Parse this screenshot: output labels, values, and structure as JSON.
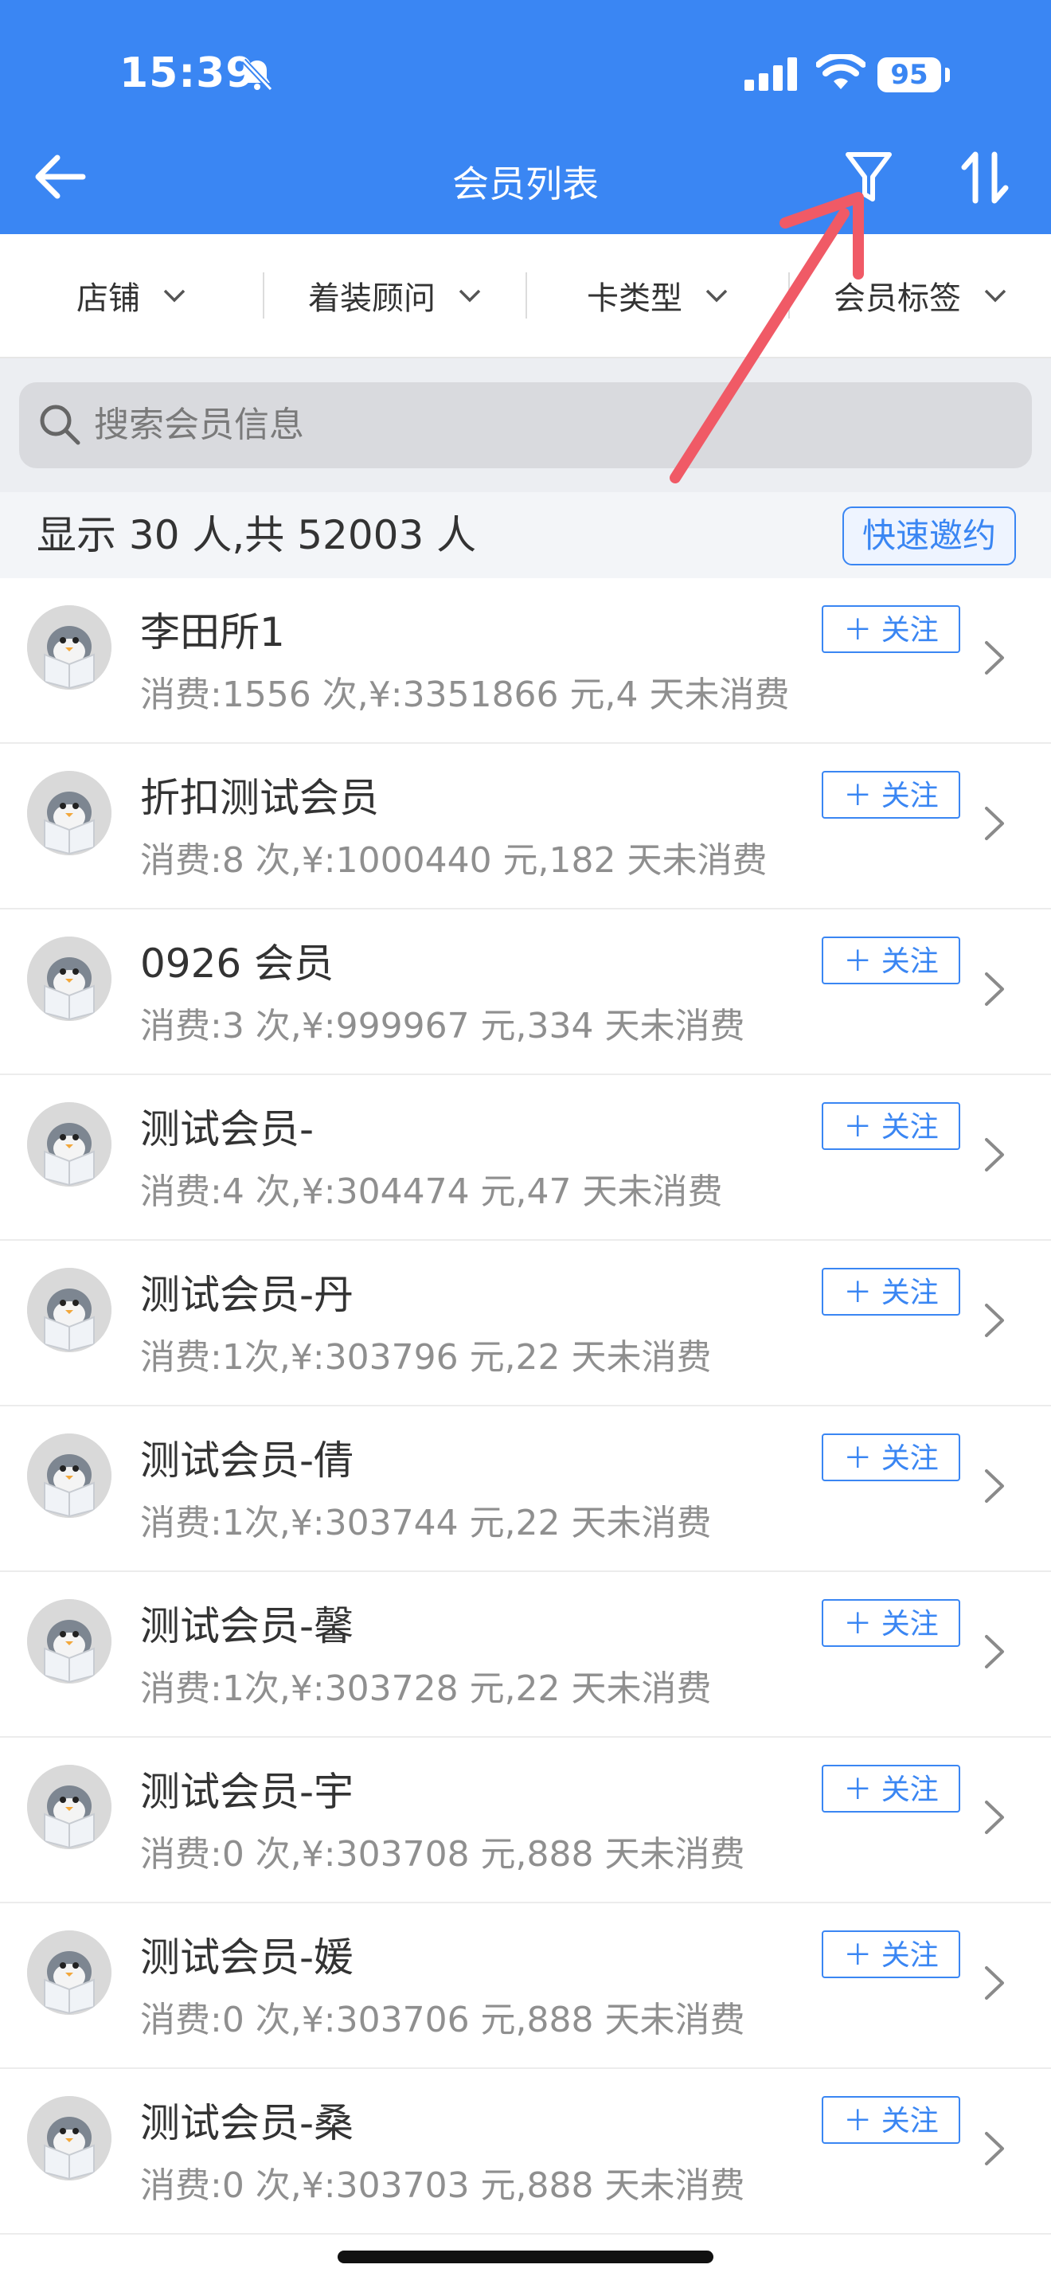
{
  "status_bar": {
    "time": "15:39",
    "battery": "95"
  },
  "nav": {
    "title": "会员列表"
  },
  "filters": [
    "店铺",
    "着装顾问",
    "卡类型",
    "会员标签"
  ],
  "search": {
    "placeholder": "搜索会员信息"
  },
  "summary": {
    "text": "显示 30 人,共 52003 人",
    "quick_invite": "快速邀约"
  },
  "follow_label": "关注",
  "members": [
    {
      "name": "李田所1",
      "stats": "消费:1556 次,¥:3351866 元,4 天未消费"
    },
    {
      "name": "折扣测试会员",
      "stats": "消费:8 次,¥:1000440 元,182 天未消费"
    },
    {
      "name": "0926 会员",
      "stats": "消费:3 次,¥:999967 元,334 天未消费"
    },
    {
      "name": "测试会员-",
      "stats": "消费:4 次,¥:304474 元,47 天未消费"
    },
    {
      "name": "测试会员-丹",
      "stats": "消费:1次,¥:303796 元,22 天未消费"
    },
    {
      "name": "测试会员-倩",
      "stats": "消费:1次,¥:303744 元,22 天未消费"
    },
    {
      "name": "测试会员-馨",
      "stats": "消费:1次,¥:303728 元,22 天未消费"
    },
    {
      "name": "测试会员-宇",
      "stats": "消费:0 次,¥:303708 元,888 天未消费"
    },
    {
      "name": "测试会员-媛",
      "stats": "消费:0 次,¥:303706 元,888 天未消费"
    },
    {
      "name": "测试会员-桑",
      "stats": "消费:0 次,¥:303703 元,888 天未消费"
    }
  ],
  "colors": {
    "primary": "#3a86f3",
    "annotation_arrow": "#f05a66"
  },
  "icons": [
    "back-arrow-icon",
    "filter-icon",
    "sort-icon",
    "search-icon",
    "chevron-down-icon",
    "chevron-right-icon",
    "penguin-avatar-icon",
    "mute-bell-icon",
    "signal-icon",
    "wifi-icon",
    "battery-icon"
  ]
}
